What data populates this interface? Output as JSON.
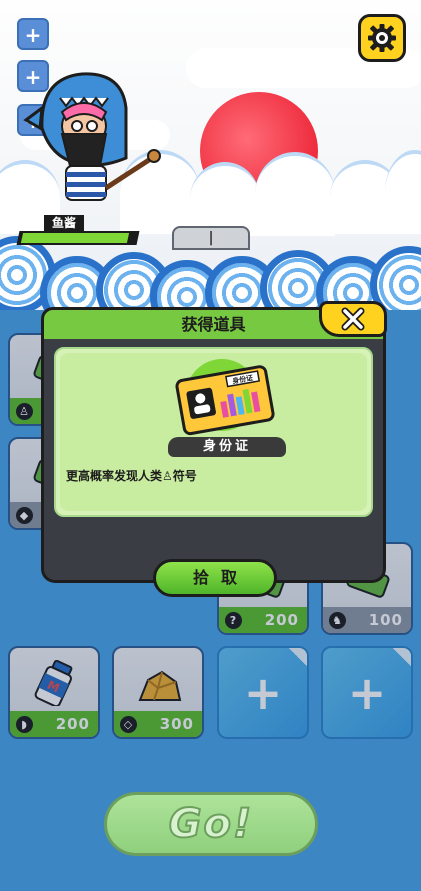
{
  "colors": {
    "accent_green": "#77c941",
    "accent_yellow": "#ffd21f",
    "background_blue": "#4aa6ea",
    "dark": "#1d1d1d"
  },
  "top": {
    "side_buttons": [
      {
        "label": "+"
      },
      {
        "label": "+"
      },
      {
        "label": "+"
      }
    ],
    "settings_icon": "gear-icon",
    "character": {
      "name": "鱼酱",
      "hp_fraction": 0.95
    },
    "tab_marker": "|"
  },
  "inventory": {
    "slots": [
      {
        "kind": "item",
        "icon": "item-icon",
        "cost": "",
        "cost_icon": "person-icon",
        "style": "green"
      },
      {
        "kind": "item",
        "icon": "item-icon",
        "cost": "",
        "cost_icon": "tag-icon",
        "style": "grey"
      },
      {
        "kind": "item",
        "icon": "item-icon",
        "cost": "100",
        "cost_icon": "tag-icon",
        "style": "grey"
      },
      {
        "kind": "empty",
        "label": "+"
      },
      {
        "kind": "item",
        "icon": "item-icon",
        "cost": "200",
        "cost_icon": "question-icon",
        "style": "green"
      },
      {
        "kind": "item",
        "icon": "item-icon",
        "cost": "100",
        "cost_icon": "sock-icon",
        "style": "grey"
      },
      {
        "kind": "item",
        "icon": "milk-icon",
        "cost": "200",
        "cost_icon": "bread-icon",
        "style": "green"
      },
      {
        "kind": "item",
        "icon": "gold-ore-icon",
        "cost": "300",
        "cost_icon": "diamond-icon",
        "style": "green"
      },
      {
        "kind": "empty",
        "label": "+"
      },
      {
        "kind": "empty",
        "label": "+"
      }
    ]
  },
  "modal": {
    "title": "获得道具",
    "close_icon": "close-icon",
    "item_name": "身份证",
    "card_text": "身份证",
    "description": "更高概率发现人类♙符号",
    "pick_label": "拾取"
  },
  "go_button": "Go!"
}
